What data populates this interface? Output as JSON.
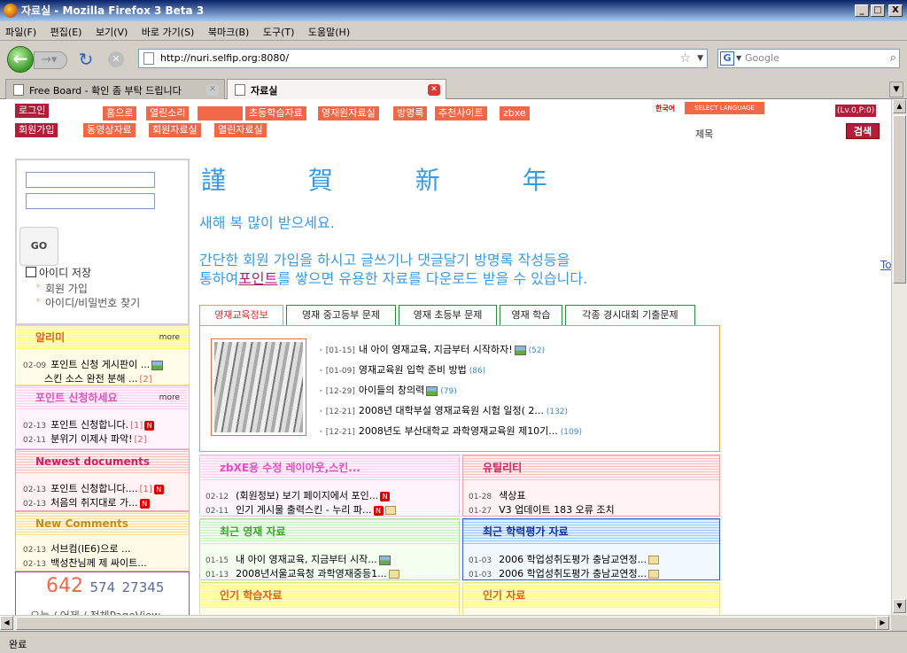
{
  "window": {
    "title": "자료실 - Mozilla Firefox 3 Beta 3",
    "minimize": "_",
    "restore": "□",
    "close": "X"
  },
  "menu": [
    "파일(F)",
    "편집(E)",
    "보기(V)",
    "바로 가기(S)",
    "북마크(B)",
    "도구(T)",
    "도움말(H)"
  ],
  "nav": {
    "url": "http://nuri.selfip.org:8080/",
    "search_placeholder": "Google"
  },
  "tabs": [
    {
      "label": "Free Board - 확인 좀 부탁 드립니다"
    },
    {
      "label": "자료실"
    }
  ],
  "status": "완료",
  "site": {
    "login_btn": "로그인",
    "join_btn": "회원가입",
    "menu_row1": [
      "홈으로",
      "열린소리",
      "초등학습자료",
      "영재원자료실",
      "방명록",
      "추천사이트",
      "zbxe"
    ],
    "menu_row2": [
      "동영상자료",
      "회원자료실",
      "열린자료실"
    ],
    "lang": "한국어",
    "select_language": "SELECT LANGUAGE",
    "level": "(Lv.0,P:0)",
    "search_label": "제목",
    "search_btn": "검색",
    "login": {
      "go": "GO",
      "save_id": "아이디 저장",
      "join_link": "회원 가입",
      "find_link": "아이디/비밀번호 찾기"
    },
    "headline": "謹 賀 新 年",
    "msg1": "새해 복 많이 받으세요.",
    "msg2": "간단한 회원 가입을 하시고 글쓰기나 댓글달기 방명록 작성등을",
    "msg3a": "통하여",
    "msg3b": "포인트",
    "msg3c": "를 쌓으면 유용한 자료를 다운로드 받을 수 있습니다.",
    "right_link": "To",
    "tabs": [
      "영재교육정보",
      "영재 중고등부 문제",
      "영재 초등부 문제",
      "영재 학습",
      "각종 경시대회 기출문제"
    ],
    "news": [
      {
        "date": "[01-15]",
        "title": "내 아이 영재교육, 지금부터 시작하자!",
        "count": "(52)"
      },
      {
        "date": "[01-09]",
        "title": "영재교육원 입학 준비 방법",
        "count": "(86)"
      },
      {
        "date": "[12-29]",
        "title": "아이들의 창의력",
        "count": "(79)"
      },
      {
        "date": "[12-21]",
        "title": "2008년 대학부설 영재교육원 시험 일정( 2...",
        "count": "(132)"
      },
      {
        "date": "[12-21]",
        "title": "2008년도 부산대학교 과학영재교육원 제10기...",
        "count": "(109)"
      }
    ],
    "side": {
      "notice": {
        "title": "알리미",
        "more": "more",
        "rows": [
          {
            "date": "02-09",
            "text": "포인트 신청 게시판이 ..."
          },
          {
            "date": "",
            "text": "스킨 소스 완전 분해 ...",
            "extra": "[2]"
          }
        ]
      },
      "point": {
        "title": "포인트 신청하세요",
        "more": "more",
        "rows": [
          {
            "date": "02-13",
            "text": "포인트 신청합니다.",
            "extra": "[1]"
          },
          {
            "date": "02-11",
            "text": "분위기 이제사 파악!",
            "extra": "[2]"
          }
        ]
      },
      "newest": {
        "title": "Newest documents",
        "rows": [
          {
            "date": "02-13",
            "text": "포인트 신청합니다....",
            "extra": "[1]"
          },
          {
            "date": "02-13",
            "text": "처음의 취지대로 가..."
          }
        ]
      },
      "comments": {
        "title": "New Comments",
        "rows": [
          {
            "date": "02-13",
            "text": "서브컴(IE6)으로 ..."
          },
          {
            "date": "02-13",
            "text": "백성찬님께 제 싸이트..."
          }
        ]
      },
      "counter": {
        "today": "642",
        "yesterday": "574",
        "total": "27345",
        "label": "오늘 / 어제 / 전체PageView"
      }
    },
    "boxes": {
      "skin": {
        "title": "zbXE용 수정 레이아웃,스킨...",
        "rows": [
          {
            "date": "02-12",
            "text": "(회원정보) 보기 페이지에서 포인..."
          },
          {
            "date": "02-11",
            "text": "인기 게시물 출력스킨 - 누리 파..."
          }
        ]
      },
      "util": {
        "title": "유틸리티",
        "rows": [
          {
            "date": "01-28",
            "text": "색상표"
          },
          {
            "date": "01-27",
            "text": "V3 업데이트 183 오류 조치"
          }
        ]
      },
      "recent": {
        "title": "최근 영재 자료",
        "rows": [
          {
            "date": "01-15",
            "text": "내 아이 영재교육, 지금부터 시작..."
          },
          {
            "date": "01-13",
            "text": "2008년서울교육청 과학영재중등1..."
          }
        ]
      },
      "eval": {
        "title": "최근 학력평가 자료",
        "rows": [
          {
            "date": "01-03",
            "text": "2006 학업성취도평가 충남교연정..."
          },
          {
            "date": "01-03",
            "text": "2006 학업성취도평가 충남교연정..."
          }
        ]
      },
      "popular": {
        "title": "인기 학습자료"
      },
      "popular2": {
        "title": "인기 자료"
      }
    }
  }
}
